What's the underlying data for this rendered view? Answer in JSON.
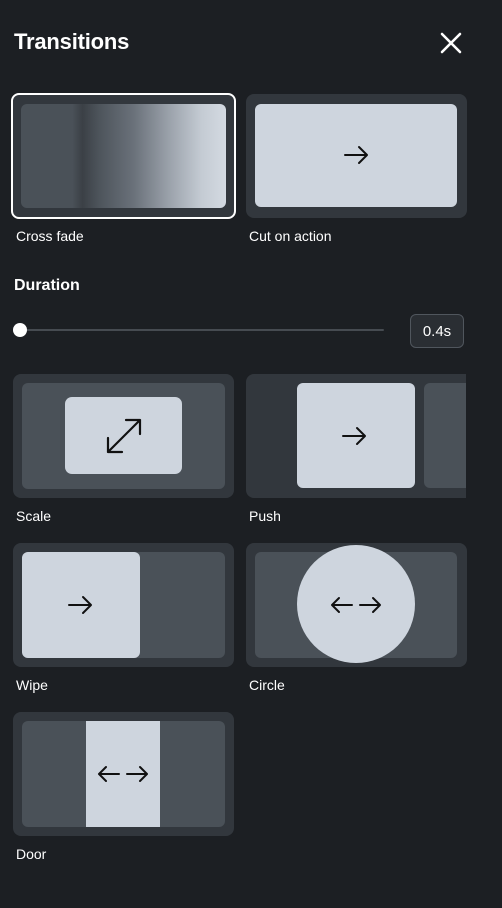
{
  "header": {
    "title": "Transitions"
  },
  "icons": {
    "close": "close-icon",
    "arrow": "arrow-right-icon",
    "expand": "expand-diagonal-icon",
    "double": "double-arrow-icon"
  },
  "transitions": [
    {
      "id": "cross-fade",
      "label": "Cross fade",
      "selected": true
    },
    {
      "id": "cut-on-action",
      "label": "Cut on action",
      "selected": false
    },
    {
      "id": "scale",
      "label": "Scale",
      "selected": false
    },
    {
      "id": "push",
      "label": "Push",
      "selected": false
    },
    {
      "id": "wipe",
      "label": "Wipe",
      "selected": false
    },
    {
      "id": "circle",
      "label": "Circle",
      "selected": false
    },
    {
      "id": "door",
      "label": "Door",
      "selected": false
    }
  ],
  "duration": {
    "label": "Duration",
    "value_text": "0.4s",
    "slider_fraction": 0
  },
  "colors": {
    "background": "#1c1f23",
    "card": "#32373d",
    "card_inner": "#4a5158",
    "pale": "#ced5de",
    "selected_border": "#ffffff"
  }
}
